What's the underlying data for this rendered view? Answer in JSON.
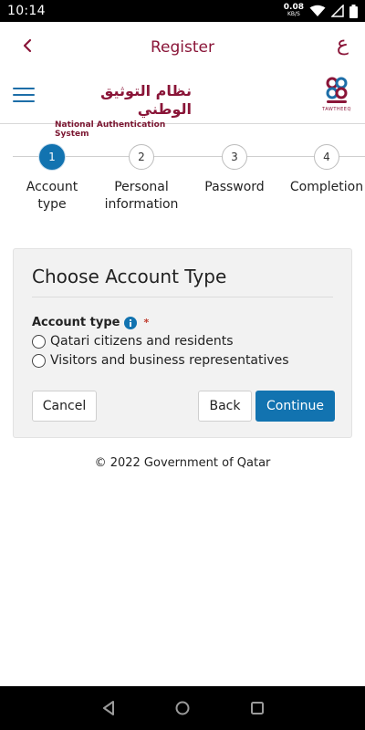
{
  "status_bar": {
    "time": "10:14",
    "net_speed": "0.08",
    "net_unit": "KB/S",
    "icons": [
      "wifi-icon",
      "signal-icon",
      "battery-icon"
    ]
  },
  "app_bar": {
    "title": "Register",
    "back_icon": "chevron-left-icon",
    "language_toggle": "ع"
  },
  "logo_bar": {
    "menu_icon": "hamburger-menu-icon",
    "nas_arabic": "نظام التوثيق الوطني",
    "nas_english": "National Authentication System",
    "tawtheeq_label": "TAWTHEEQ"
  },
  "stepper": {
    "steps": [
      {
        "number": "1",
        "label": "Account type",
        "active": true
      },
      {
        "number": "2",
        "label": "Personal information",
        "active": false
      },
      {
        "number": "3",
        "label": "Password",
        "active": false
      },
      {
        "number": "4",
        "label": "Completion",
        "active": false
      }
    ]
  },
  "card": {
    "title": "Choose Account Type",
    "field_label": "Account type",
    "required_mark": "*",
    "options": [
      {
        "label": "Qatari citizens and residents",
        "selected": false
      },
      {
        "label": "Visitors and business representatives",
        "selected": false
      }
    ],
    "buttons": {
      "cancel": "Cancel",
      "back": "Back",
      "continue": "Continue"
    }
  },
  "footer": {
    "copyright": "© 2022 Government of Qatar"
  },
  "colors": {
    "brand_maroon": "#8a1538",
    "primary_blue": "#1273b0"
  }
}
